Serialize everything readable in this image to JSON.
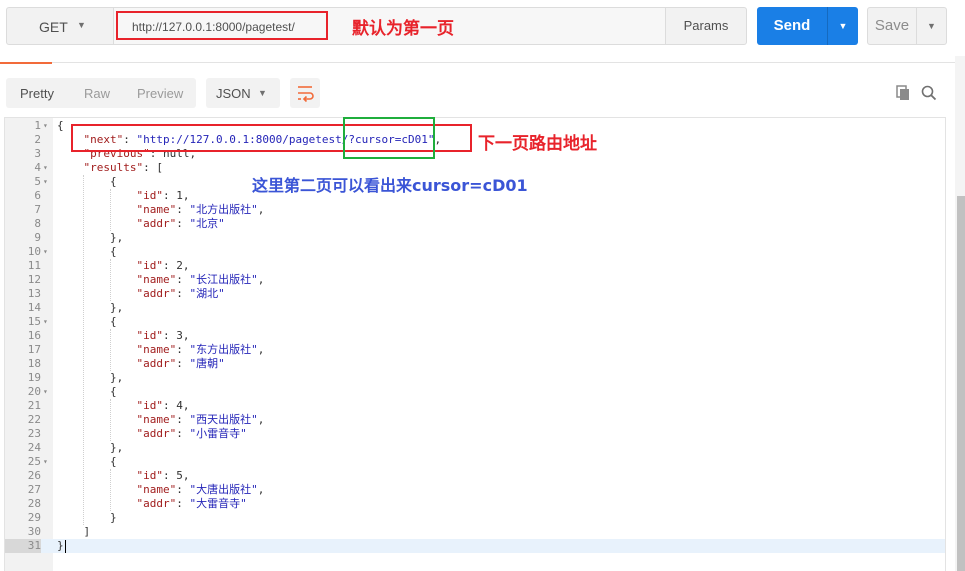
{
  "request": {
    "method": "GET",
    "url": "http://127.0.0.1:8000/pagetest/",
    "params_label": "Params",
    "send_label": "Send",
    "save_label": "Save"
  },
  "annotations": {
    "default_first_page": "默认为第一页",
    "next_page_route": "下一页路由地址",
    "second_page_note": "这里第二页可以看出来cursor=cD01"
  },
  "response_toolbar": {
    "tabs": [
      "Pretty",
      "Raw",
      "Preview"
    ],
    "active_tab": "Pretty",
    "format": "JSON",
    "icons": [
      "wrap-lines-icon",
      "copy-icon",
      "search-icon"
    ]
  },
  "colors": {
    "send_blue": "#1a7fe6",
    "annotation_red": "#e8232b",
    "annotation_green": "#1fae3c",
    "annotation_blue": "#3b55d6",
    "json_key": "#a11d1d",
    "json_string": "#2525b8",
    "active_tab_underline": "#f26b3a"
  },
  "code_lines": [
    {
      "n": "1",
      "fold": true,
      "text": "{"
    },
    {
      "n": "2",
      "fold": false,
      "text": "    \"next\": \"http://127.0.0.1:8000/pagetest/?cursor=cD01\","
    },
    {
      "n": "3",
      "fold": false,
      "text": "    \"previous\": null,"
    },
    {
      "n": "4",
      "fold": true,
      "text": "    \"results\": ["
    },
    {
      "n": "5",
      "fold": true,
      "text": "        {"
    },
    {
      "n": "6",
      "fold": false,
      "text": "            \"id\": 1,"
    },
    {
      "n": "7",
      "fold": false,
      "text": "            \"name\": \"北方出版社\","
    },
    {
      "n": "8",
      "fold": false,
      "text": "            \"addr\": \"北京\""
    },
    {
      "n": "9",
      "fold": false,
      "text": "        },"
    },
    {
      "n": "10",
      "fold": true,
      "text": "        {"
    },
    {
      "n": "11",
      "fold": false,
      "text": "            \"id\": 2,"
    },
    {
      "n": "12",
      "fold": false,
      "text": "            \"name\": \"长江出版社\","
    },
    {
      "n": "13",
      "fold": false,
      "text": "            \"addr\": \"湖北\""
    },
    {
      "n": "14",
      "fold": false,
      "text": "        },"
    },
    {
      "n": "15",
      "fold": true,
      "text": "        {"
    },
    {
      "n": "16",
      "fold": false,
      "text": "            \"id\": 3,"
    },
    {
      "n": "17",
      "fold": false,
      "text": "            \"name\": \"东方出版社\","
    },
    {
      "n": "18",
      "fold": false,
      "text": "            \"addr\": \"唐朝\""
    },
    {
      "n": "19",
      "fold": false,
      "text": "        },"
    },
    {
      "n": "20",
      "fold": true,
      "text": "        {"
    },
    {
      "n": "21",
      "fold": false,
      "text": "            \"id\": 4,"
    },
    {
      "n": "22",
      "fold": false,
      "text": "            \"name\": \"西天出版社\","
    },
    {
      "n": "23",
      "fold": false,
      "text": "            \"addr\": \"小雷音寺\""
    },
    {
      "n": "24",
      "fold": false,
      "text": "        },"
    },
    {
      "n": "25",
      "fold": true,
      "text": "        {"
    },
    {
      "n": "26",
      "fold": false,
      "text": "            \"id\": 5,"
    },
    {
      "n": "27",
      "fold": false,
      "text": "            \"name\": \"大唐出版社\","
    },
    {
      "n": "28",
      "fold": false,
      "text": "            \"addr\": \"大雷音寺\""
    },
    {
      "n": "29",
      "fold": false,
      "text": "        }"
    },
    {
      "n": "30",
      "fold": false,
      "text": "    ]"
    },
    {
      "n": "31",
      "fold": false,
      "text": "}",
      "active": true
    }
  ]
}
